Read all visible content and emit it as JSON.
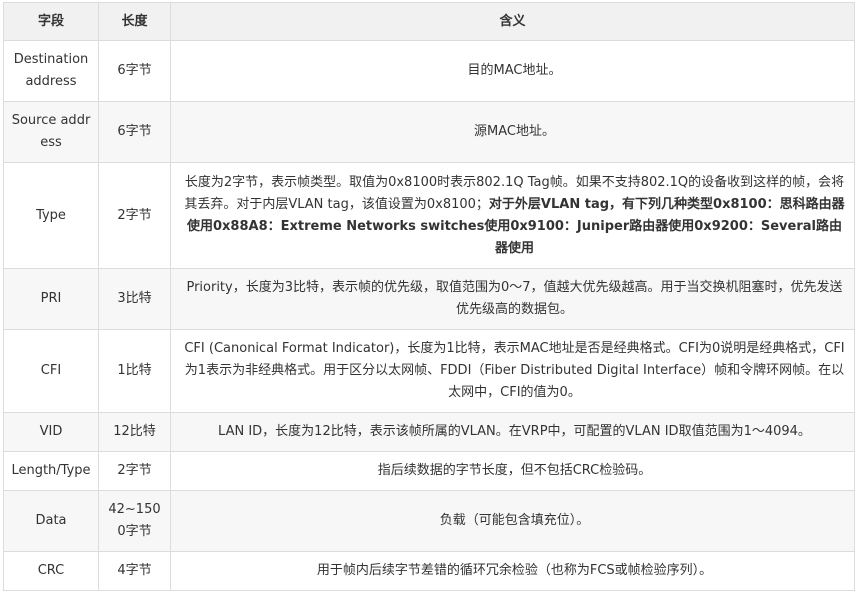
{
  "headers": [
    "字段",
    "长度",
    "含义"
  ],
  "rows": [
    {
      "field": "Destination address",
      "length": "6字节",
      "meaning": "目的MAC地址。"
    },
    {
      "field": "Source address",
      "length": "6字节",
      "meaning": "源MAC地址。"
    },
    {
      "field": "Type",
      "length": "2字节",
      "meaning": "长度为2字节，表示帧类型。取值为0x8100时表示802.1Q Tag帧。如果不支持802.1Q的设备收到这样的帧，会将其丢弃。对于内层VLAN tag，该值设置为0x8100；",
      "meaning_bold": "对于外层VLAN tag，有下列几种类型0x8100：思科路由器使用0x88A8：Extreme Networks switches使用0x9100：Juniper路由器使用0x9200：Several路由器使用"
    },
    {
      "field": "PRI",
      "length": "3比特",
      "meaning": "Priority，长度为3比特，表示帧的优先级，取值范围为0～7，值越大优先级越高。用于当交换机阻塞时，优先发送优先级高的数据包。"
    },
    {
      "field": "CFI",
      "length": "1比特",
      "meaning": "CFI (Canonical Format Indicator)，长度为1比特，表示MAC地址是否是经典格式。CFI为0说明是经典格式，CFI为1表示为非经典格式。用于区分以太网帧、FDDI（Fiber Distributed Digital Interface）帧和令牌环网帧。在以太网中，CFI的值为0。"
    },
    {
      "field": "VID",
      "length": "12比特",
      "meaning": "LAN ID，长度为12比特，表示该帧所属的VLAN。在VRP中，可配置的VLAN ID取值范围为1～4094。"
    },
    {
      "field": "Length/Type",
      "length": "2字节",
      "meaning": "指后续数据的字节长度，但不包括CRC检验码。"
    },
    {
      "field": "Data",
      "length": "42~1500字节",
      "meaning": "负载（可能包含填充位）。"
    },
    {
      "field": "CRC",
      "length": "4字节",
      "meaning": "用于帧内后续字节差错的循环冗余检验（也称为FCS或帧检验序列）。"
    }
  ]
}
